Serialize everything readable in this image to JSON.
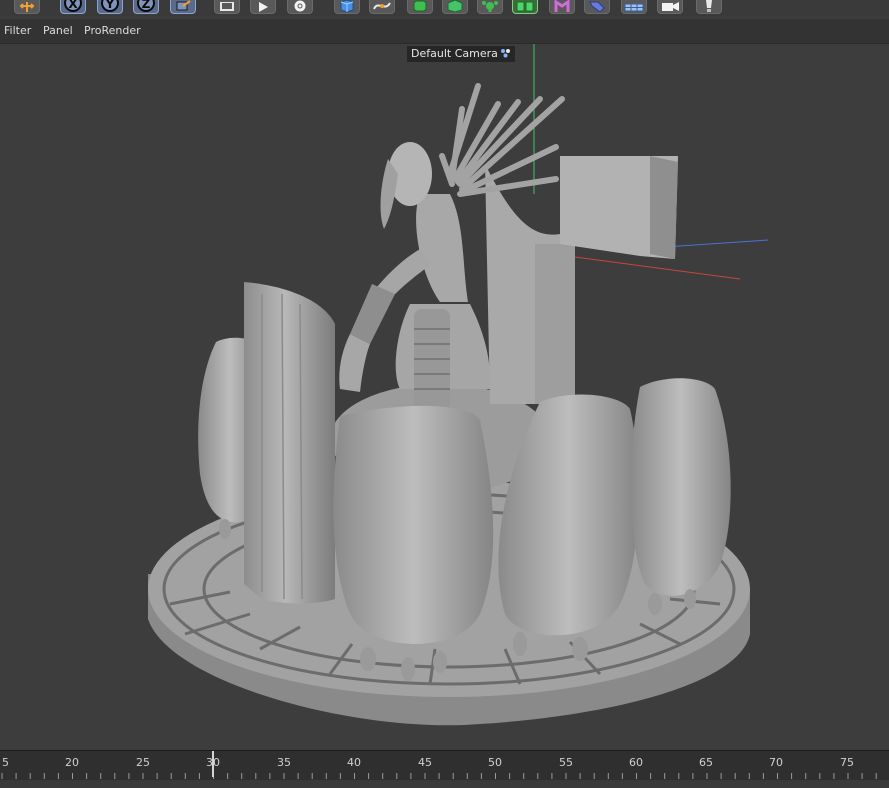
{
  "colors": {
    "viewport_bg": "#3d3d3d",
    "model": "#a8a8a8",
    "axis_x": "#c8463c",
    "axis_y": "#3fc26a",
    "axis_z": "#4a72d6"
  },
  "toolbar": {
    "buttons": [
      {
        "icon": "move-icon"
      },
      {
        "icon": "axis-x-lock-icon",
        "label": "X"
      },
      {
        "icon": "axis-y-lock-icon",
        "label": "Y"
      },
      {
        "icon": "axis-z-lock-icon",
        "label": "Z"
      },
      {
        "icon": "coordinate-system-icon"
      },
      {
        "icon": "render-region-icon"
      },
      {
        "icon": "render-view-icon"
      },
      {
        "icon": "render-settings-icon"
      },
      {
        "icon": "cube-icon"
      },
      {
        "icon": "spline-pen-icon"
      },
      {
        "icon": "subdivision-surface-icon"
      },
      {
        "icon": "cloner-icon"
      },
      {
        "icon": "deformer-icon"
      },
      {
        "icon": "scene-objects-icon"
      },
      {
        "icon": "sketch-icon"
      },
      {
        "icon": "tag-icon"
      },
      {
        "icon": "floor-icon"
      },
      {
        "icon": "camera-icon"
      },
      {
        "icon": "light-icon"
      }
    ]
  },
  "menu": {
    "items": [
      "Filter",
      "Panel",
      "ProRender"
    ]
  },
  "viewport": {
    "camera_label": "Default Camera"
  },
  "timeline": {
    "ticks": [
      "5",
      "20",
      "25",
      "30",
      "35",
      "40",
      "45",
      "50",
      "55",
      "60",
      "65",
      "70",
      "75"
    ],
    "current_frame": 30
  }
}
